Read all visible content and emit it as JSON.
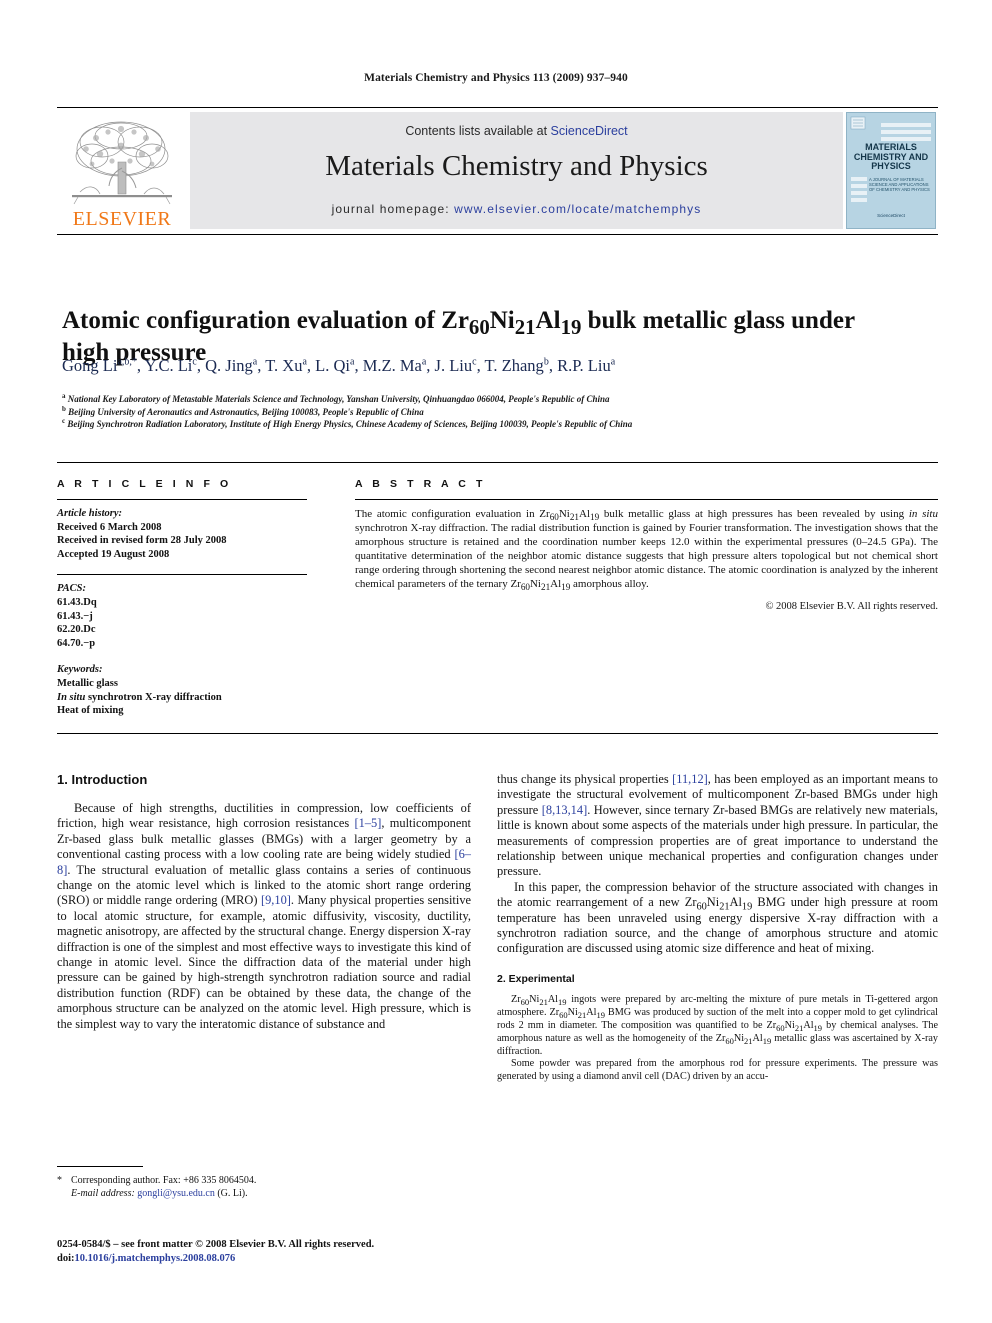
{
  "running_head": "Materials Chemistry and Physics 113 (2009) 937–940",
  "masthead": {
    "contents_prefix": "Contents lists available at ",
    "sciencedirect": "ScienceDirect",
    "journal_title": "Materials Chemistry and Physics",
    "homepage_prefix": "journal homepage: ",
    "homepage_url": "www.elsevier.com/locate/matchemphys",
    "publisher_logo_text": "ELSEVIER",
    "cover": {
      "title_line1": "MATERIALS",
      "title_line2": "CHEMISTRY AND",
      "title_line3": "PHYSICS",
      "subtitle": "A JOURNAL OF MATERIALS SCIENCE AND APPLICATIONS OF CHEMISTRY AND PHYSICS",
      "footer": "ScienceDirect"
    },
    "banner_bg": "#e6e6e8",
    "link_color": "#2b3f9e",
    "elsevier_orange": "#f07818",
    "cover_bg": "#b7d4e3"
  },
  "article": {
    "title_part1": "Atomic configuration evaluation of Zr",
    "title_sub1": "60",
    "title_part2": "Ni",
    "title_sub2": "21",
    "title_part3": "Al",
    "title_sub3": "19",
    "title_part4": " bulk metallic glass under high pressure",
    "authors": [
      {
        "name": "Gong Li",
        "marks": "a,b,*"
      },
      {
        "name": "Y.C. Li",
        "marks": "c"
      },
      {
        "name": "Q. Jing",
        "marks": "a"
      },
      {
        "name": "T. Xu",
        "marks": "a"
      },
      {
        "name": "L. Qi",
        "marks": "a"
      },
      {
        "name": "M.Z. Ma",
        "marks": "a"
      },
      {
        "name": "J. Liu",
        "marks": "c"
      },
      {
        "name": "T. Zhang",
        "marks": "b"
      },
      {
        "name": "R.P. Liu",
        "marks": "a"
      }
    ],
    "affiliations": [
      {
        "mark": "a",
        "text": "National Key Laboratory of Metastable Materials Science and Technology, Yanshan University, Qinhuangdao 066004, People's Republic of China"
      },
      {
        "mark": "b",
        "text": "Beijing University of Aeronautics and Astronautics, Beijing 100083, People's Republic of China"
      },
      {
        "mark": "c",
        "text": "Beijing Synchrotron Radiation Laboratory, Institute of High Energy Physics, Chinese Academy of Sciences, Beijing 100039, People's Republic of China"
      }
    ]
  },
  "article_info": {
    "heading": "A R T I C L E   I N F O",
    "history_label": "Article history:",
    "history": [
      "Received 6 March 2008",
      "Received in revised form 28 July 2008",
      "Accepted 19 August 2008"
    ],
    "pacs_label": "PACS:",
    "pacs": [
      "61.43.Dq",
      "61.43.−j",
      "62.20.Dc",
      "64.70.−p"
    ],
    "keywords_label": "Keywords:",
    "keywords": [
      "Metallic glass",
      "In situ synchrotron X-ray diffraction",
      "Heat of mixing"
    ]
  },
  "abstract": {
    "heading": "A B S T R A C T",
    "body_1": "The atomic configuration evaluation in Zr",
    "body_2": "Ni",
    "body_3": "Al",
    "body_4": " bulk metallic glass at high pressures has been revealed by using ",
    "in_situ": "in situ",
    "body_5": " synchrotron X-ray diffraction. The radial distribution function is gained by Fourier transformation. The investigation shows that the amorphous structure is retained and the coordination number keeps 12.0 within the experimental pressures (0–24.5 GPa). The quantitative determination of the neighbor atomic distance suggests that high pressure alters topological but not chemical short range ordering through shortening the second nearest neighbor atomic distance. The atomic coordination is analyzed by the inherent chemical parameters of the ternary Zr",
    "body_6": "Ni",
    "body_7": "Al",
    "body_8": " amorphous alloy.",
    "sub_60": "60",
    "sub_21": "21",
    "sub_19": "19",
    "copyright": "© 2008 Elsevier B.V. All rights reserved."
  },
  "sections": {
    "introduction_heading": "1.  Introduction",
    "intro_p1_a": "Because of high strengths, ductilities in compression, low coefficients of friction, high wear resistance, high corrosion resistances ",
    "intro_cite1": "[1–5]",
    "intro_p1_b": ", multicomponent Zr-based glass bulk metallic glasses (BMGs) with a larger geometry by a conventional casting process with a low cooling rate are being widely studied ",
    "intro_cite2": "[6–8]",
    "intro_p1_c": ". The structural evaluation of metallic glass contains a series of continuous change on the atomic level which is linked to the atomic short range ordering (SRO) or middle range ordering (MRO) ",
    "intro_cite3": "[9,10]",
    "intro_p1_d": ". Many physical properties sensitive to local atomic structure, for example, atomic diffusivity, viscosity, ductility, magnetic anisotropy, are affected by the structural change. Energy dispersion X-ray diffraction is one of the simplest and most effective ways to investigate this kind of change in atomic level. Since the diffraction data of the material under high pressure can be gained by high-strength synchrotron radiation source and radial distribution function (RDF) can be obtained by these data, the change of the amorphous structure can be analyzed on the atomic level. High pressure, which is the simplest way to vary the interatomic distance of substance and",
    "right_p1_a": "thus change its physical properties ",
    "right_cite1": "[11,12]",
    "right_p1_b": ", has been employed as an important means to investigate the structural evolvement of multicomponent Zr-based BMGs under high pressure ",
    "right_cite2": "[8,13,14]",
    "right_p1_c": ". However, since ternary Zr-based BMGs are relatively new materials, little is known about some aspects of the materials under high pressure. In particular, the measurements of compression properties are of great importance to understand the relationship between unique mechanical properties and configuration changes under pressure.",
    "right_p2_a": "In this paper, the compression behavior of the structure associated with changes in the atomic rearrangement of a new Zr",
    "right_p2_b": "Ni",
    "right_p2_c": "Al",
    "right_p2_d": " BMG under high pressure at room temperature has been unraveled using energy dispersive X-ray diffraction with a synchrotron radiation source, and the change of amorphous structure and atomic configuration are discussed using atomic size difference and heat of mixing.",
    "experimental_heading": "2.  Experimental",
    "exp_p1_a": "Zr",
    "exp_p1_b": "Ni",
    "exp_p1_c": "Al",
    "exp_p1_d": " ingots were prepared by arc-melting the mixture of pure metals in Ti-gettered argon atmosphere. Zr",
    "exp_p1_e": " BMG was produced by suction of the melt into a copper mold to get cylindrical rods 2 mm in diameter. The composition was quantified to be Zr",
    "exp_p1_f": " by chemical analyses. The amorphous nature as well as the homogeneity of the Zr",
    "exp_p1_g": " metallic glass was ascertained by X-ray diffraction.",
    "exp_p2": "Some powder was prepared from the amorphous rod for pressure experiments. The pressure was generated by using a diamond anvil cell (DAC) driven by an accu-"
  },
  "footnotes": {
    "corresponding_marker": "*",
    "corresponding": "Corresponding author. Fax: +86 335 8064504.",
    "email_label": "E-mail address:",
    "email": "gongli@ysu.edu.cn",
    "email_suffix": " (G. Li).",
    "imprint": "0254-0584/$ – see front matter © 2008 Elsevier B.V. All rights reserved.",
    "doi_label": "doi:",
    "doi": "10.1016/j.matchemphys.2008.08.076"
  }
}
